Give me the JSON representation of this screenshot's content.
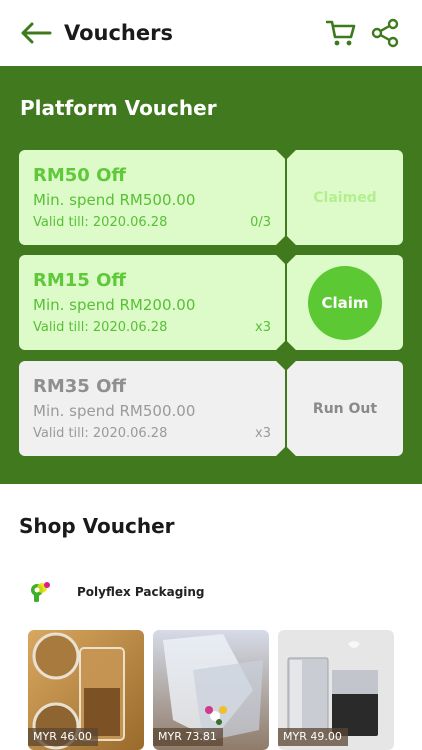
{
  "header": {
    "title": "Vouchers",
    "back_icon": "arrow-left-icon",
    "cart_icon": "cart-icon",
    "share_icon": "share-icon"
  },
  "colors": {
    "brand_green": "#417a1e",
    "accent_green": "#5cc934",
    "voucher_bg": "#dcfbc9",
    "disabled_bg": "#f0f0f0"
  },
  "platform": {
    "title": "Platform Voucher",
    "vouchers": [
      {
        "amount": "RM50 Off",
        "min_spend": "Min. spend RM500.00",
        "valid": "Valid till: 2020.06.28",
        "count": "0/3",
        "action": "Claimed",
        "state": "claimed"
      },
      {
        "amount": "RM15 Off",
        "min_spend": "Min. spend RM200.00",
        "valid": "Valid till: 2020.06.28",
        "count": "x3",
        "action": "Claim",
        "state": "claimable"
      },
      {
        "amount": "RM35 Off",
        "min_spend": "Min. spend RM500.00",
        "valid": "Valid till: 2020.06.28",
        "count": "x3",
        "action": "Run Out",
        "state": "run-out"
      }
    ]
  },
  "shop": {
    "title": "Shop Voucher",
    "store_name": "Polyflex Packaging",
    "store_logo_icon": "polyflex-logo-icon",
    "products": [
      {
        "price": "MYR 46.00"
      },
      {
        "price": "MYR 73.81"
      },
      {
        "price": "MYR 49.00"
      }
    ]
  }
}
